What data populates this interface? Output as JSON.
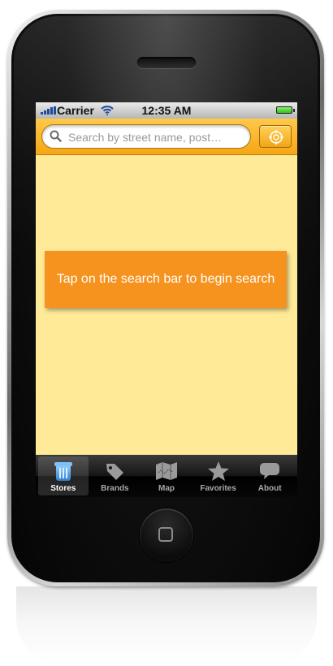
{
  "status_bar": {
    "carrier": "Carrier",
    "time": "12:35 AM"
  },
  "search": {
    "placeholder": "Search by street name, post…"
  },
  "content": {
    "hint": "Tap on the search bar to begin search"
  },
  "tabs": [
    {
      "label": "Stores",
      "icon": "stores-icon",
      "active": true
    },
    {
      "label": "Brands",
      "icon": "tag-icon",
      "active": false
    },
    {
      "label": "Map",
      "icon": "map-icon",
      "active": false
    },
    {
      "label": "Favorites",
      "icon": "star-icon",
      "active": false
    },
    {
      "label": "About",
      "icon": "speech-bubble-icon",
      "active": false
    }
  ],
  "colors": {
    "accent": "#f6931e",
    "search_bar": "#f5a615",
    "content_background": "#ffea98",
    "active_tab_icon": "#5aa8e6"
  }
}
